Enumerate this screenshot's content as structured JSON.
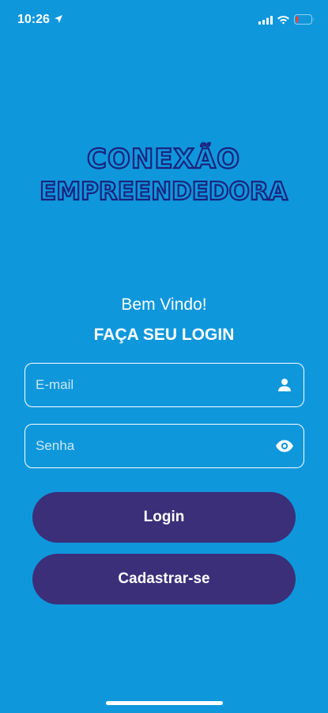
{
  "status_bar": {
    "time": "10:26",
    "icons": [
      "location-arrow-icon",
      "cellular-signal-icon",
      "wifi-icon",
      "battery-low-icon"
    ],
    "battery_color": "#ff3b30"
  },
  "brand": {
    "line1": "CONEXÃO",
    "line2": "EMPREENDEDORA",
    "color": "#1a237e"
  },
  "welcome_text": "Bem Vindo!",
  "login_heading": "FAÇA SEU LOGIN",
  "form": {
    "email": {
      "placeholder": "E-mail",
      "value": "",
      "icon": "user-icon"
    },
    "password": {
      "placeholder": "Senha",
      "value": "",
      "icon": "eye-icon"
    }
  },
  "buttons": {
    "login": "Login",
    "register": "Cadastrar-se"
  },
  "colors": {
    "background": "#0f97dc",
    "button": "#3a2f78",
    "text": "#ffffff"
  }
}
